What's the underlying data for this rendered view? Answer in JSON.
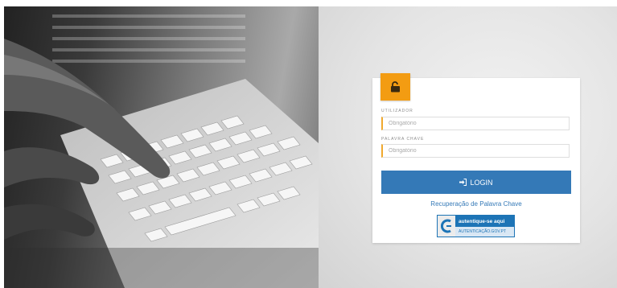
{
  "colors": {
    "accent": "#f39c12",
    "primary": "#3479b7",
    "auth_blue": "#1d74b6"
  },
  "login": {
    "lock_icon": "unlock-icon",
    "username": {
      "label": "UTILIZADOR",
      "placeholder": "Obrigatório"
    },
    "password": {
      "label": "PALAVRA CHAVE",
      "placeholder": "Obrigatório"
    },
    "login_button": {
      "icon": "sign-in-icon",
      "label": "LOGIN"
    },
    "recover_link": "Recuperação de Palavra Chave",
    "auth_badge": {
      "top": "autentique-se aqui",
      "bottom": "AUTENTICAÇÃO.GOV.PT"
    }
  }
}
